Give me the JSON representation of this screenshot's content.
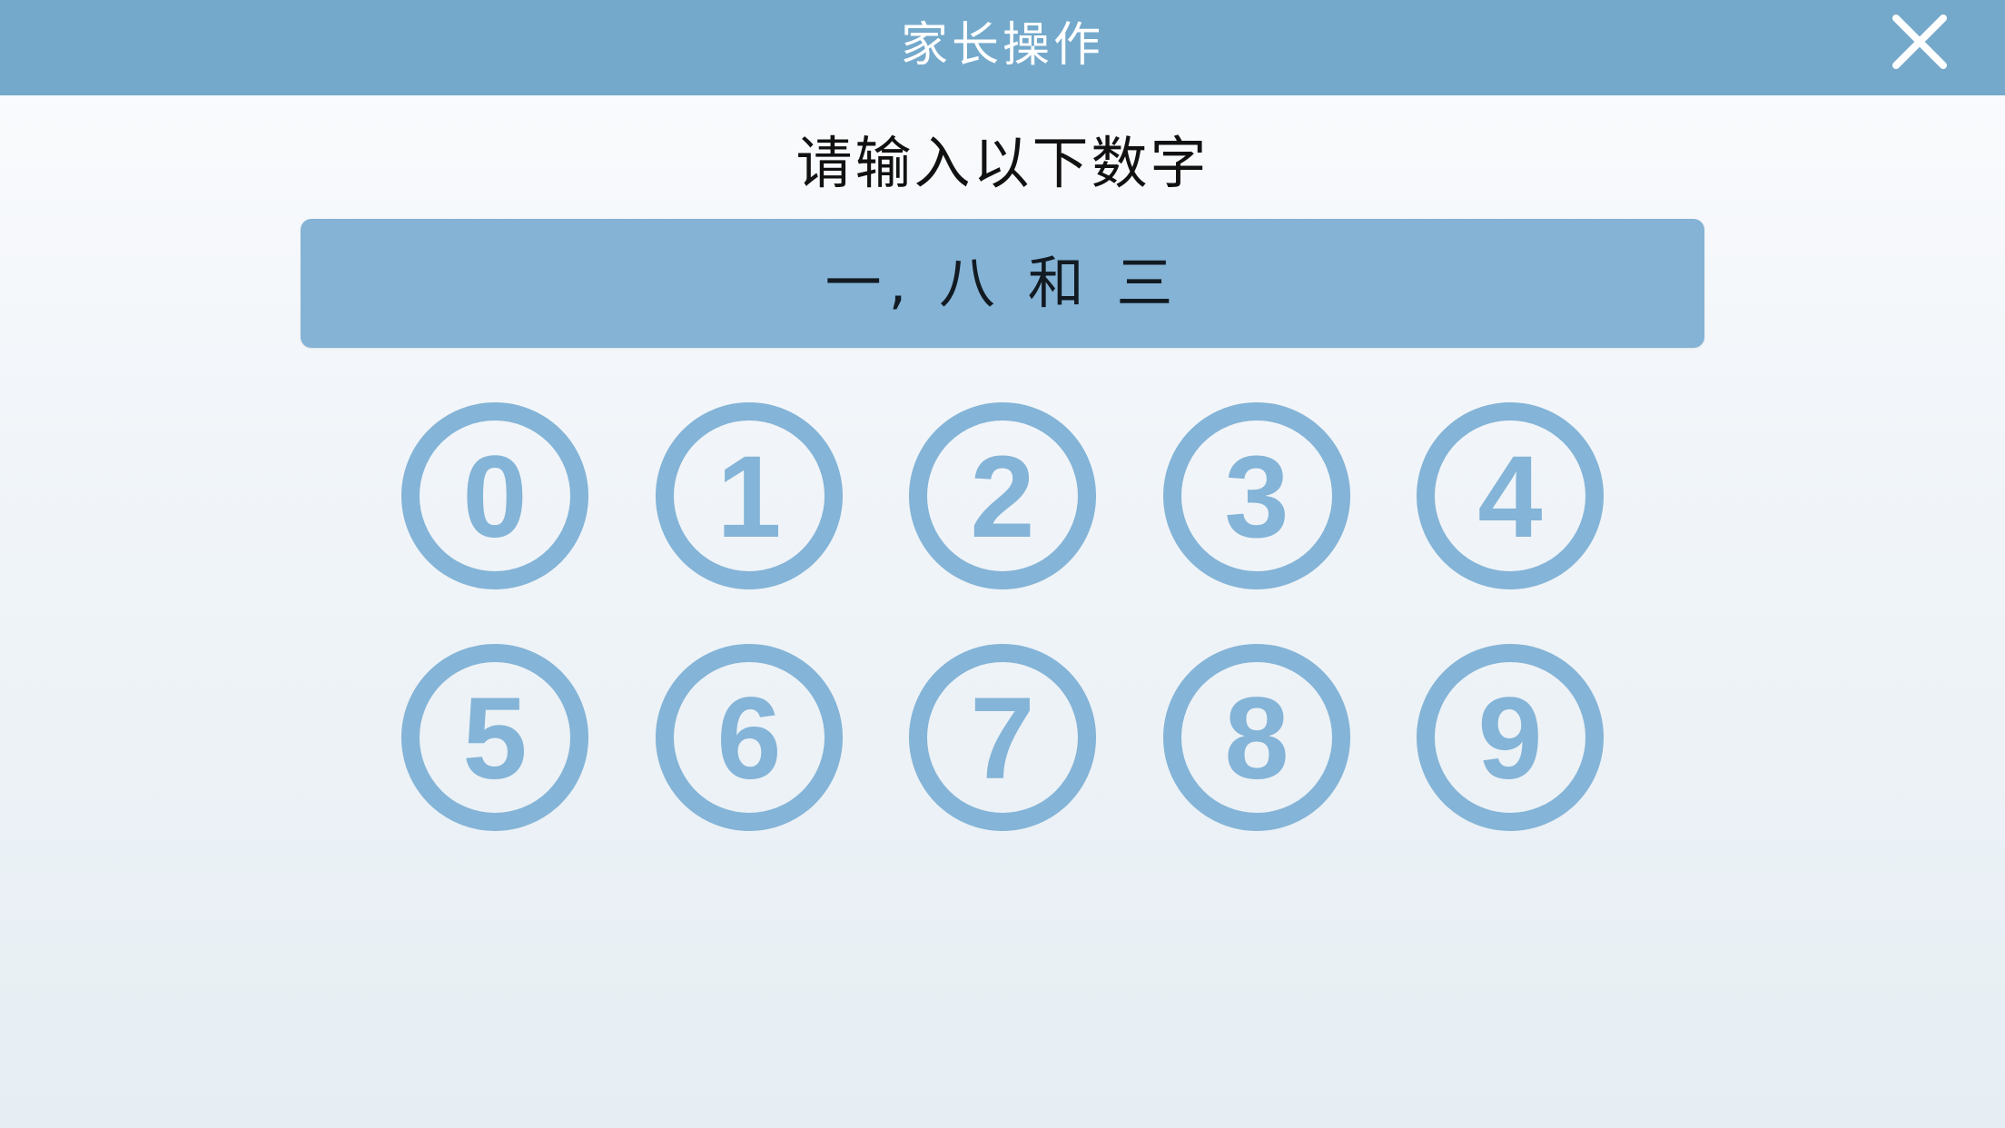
{
  "header": {
    "title": "家长操作",
    "close_icon": "close-icon",
    "background_color": "#74a9cb"
  },
  "prompt": {
    "text": "请输入以下数字"
  },
  "challenge": {
    "text": "一, 八 和 三",
    "background_color": "#84b3d5"
  },
  "keypad": {
    "keys": [
      {
        "label": "0"
      },
      {
        "label": "1"
      },
      {
        "label": "2"
      },
      {
        "label": "3"
      },
      {
        "label": "4"
      },
      {
        "label": "5"
      },
      {
        "label": "6"
      },
      {
        "label": "7"
      },
      {
        "label": "8"
      },
      {
        "label": "9"
      }
    ],
    "key_color": "#84b4d7"
  }
}
